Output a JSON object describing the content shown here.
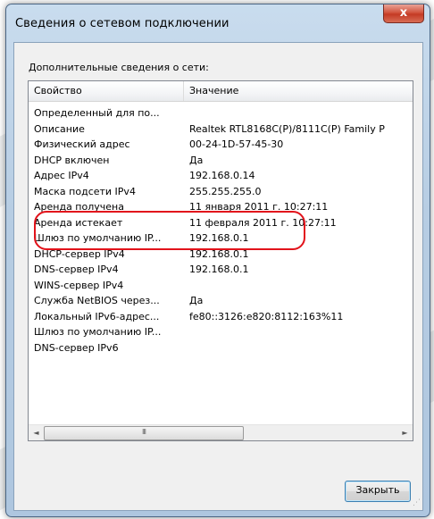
{
  "window": {
    "title": "Сведения о сетевом подключении",
    "close_glyph": "x"
  },
  "section_label": "Дополнительные сведения о сети:",
  "table": {
    "columns": [
      "Свойство",
      "Значение"
    ],
    "rows": [
      {
        "property": "Определенный для по...",
        "value": ""
      },
      {
        "property": "Описание",
        "value": "Realtek RTL8168C(P)/8111C(P) Family P"
      },
      {
        "property": "Физический адрес",
        "value": "00-24-1D-57-45-30"
      },
      {
        "property": "DHCP включен",
        "value": "Да"
      },
      {
        "property": "Адрес IPv4",
        "value": "192.168.0.14"
      },
      {
        "property": "Маска подсети IPv4",
        "value": "255.255.255.0"
      },
      {
        "property": "Аренда получена",
        "value": "11 января 2011 г. 10:27:11"
      },
      {
        "property": "Аренда истекает",
        "value": "11 февраля 2011 г. 10:27:11"
      },
      {
        "property": "Шлюз по умолчанию IP...",
        "value": "192.168.0.1"
      },
      {
        "property": "DHCP-сервер IPv4",
        "value": "192.168.0.1"
      },
      {
        "property": "DNS-сервер IPv4",
        "value": "192.168.0.1"
      },
      {
        "property": "WINS-сервер IPv4",
        "value": ""
      },
      {
        "property": "Служба NetBIOS через...",
        "value": "Да"
      },
      {
        "property": "Локальный IPv6-адрес...",
        "value": "fe80::3126:e820:8112:163%11"
      },
      {
        "property": "Шлюз по умолчанию IP...",
        "value": ""
      },
      {
        "property": "DNS-сервер IPv6",
        "value": ""
      }
    ]
  },
  "scrollbar": {
    "left_arrow": "◄",
    "right_arrow": "►",
    "grip": "III"
  },
  "buttons": {
    "close_label": "Закрыть"
  },
  "colors": {
    "highlight": "#e2131b",
    "titlebar": "#b7cde3",
    "close_button": "#c43a24"
  }
}
